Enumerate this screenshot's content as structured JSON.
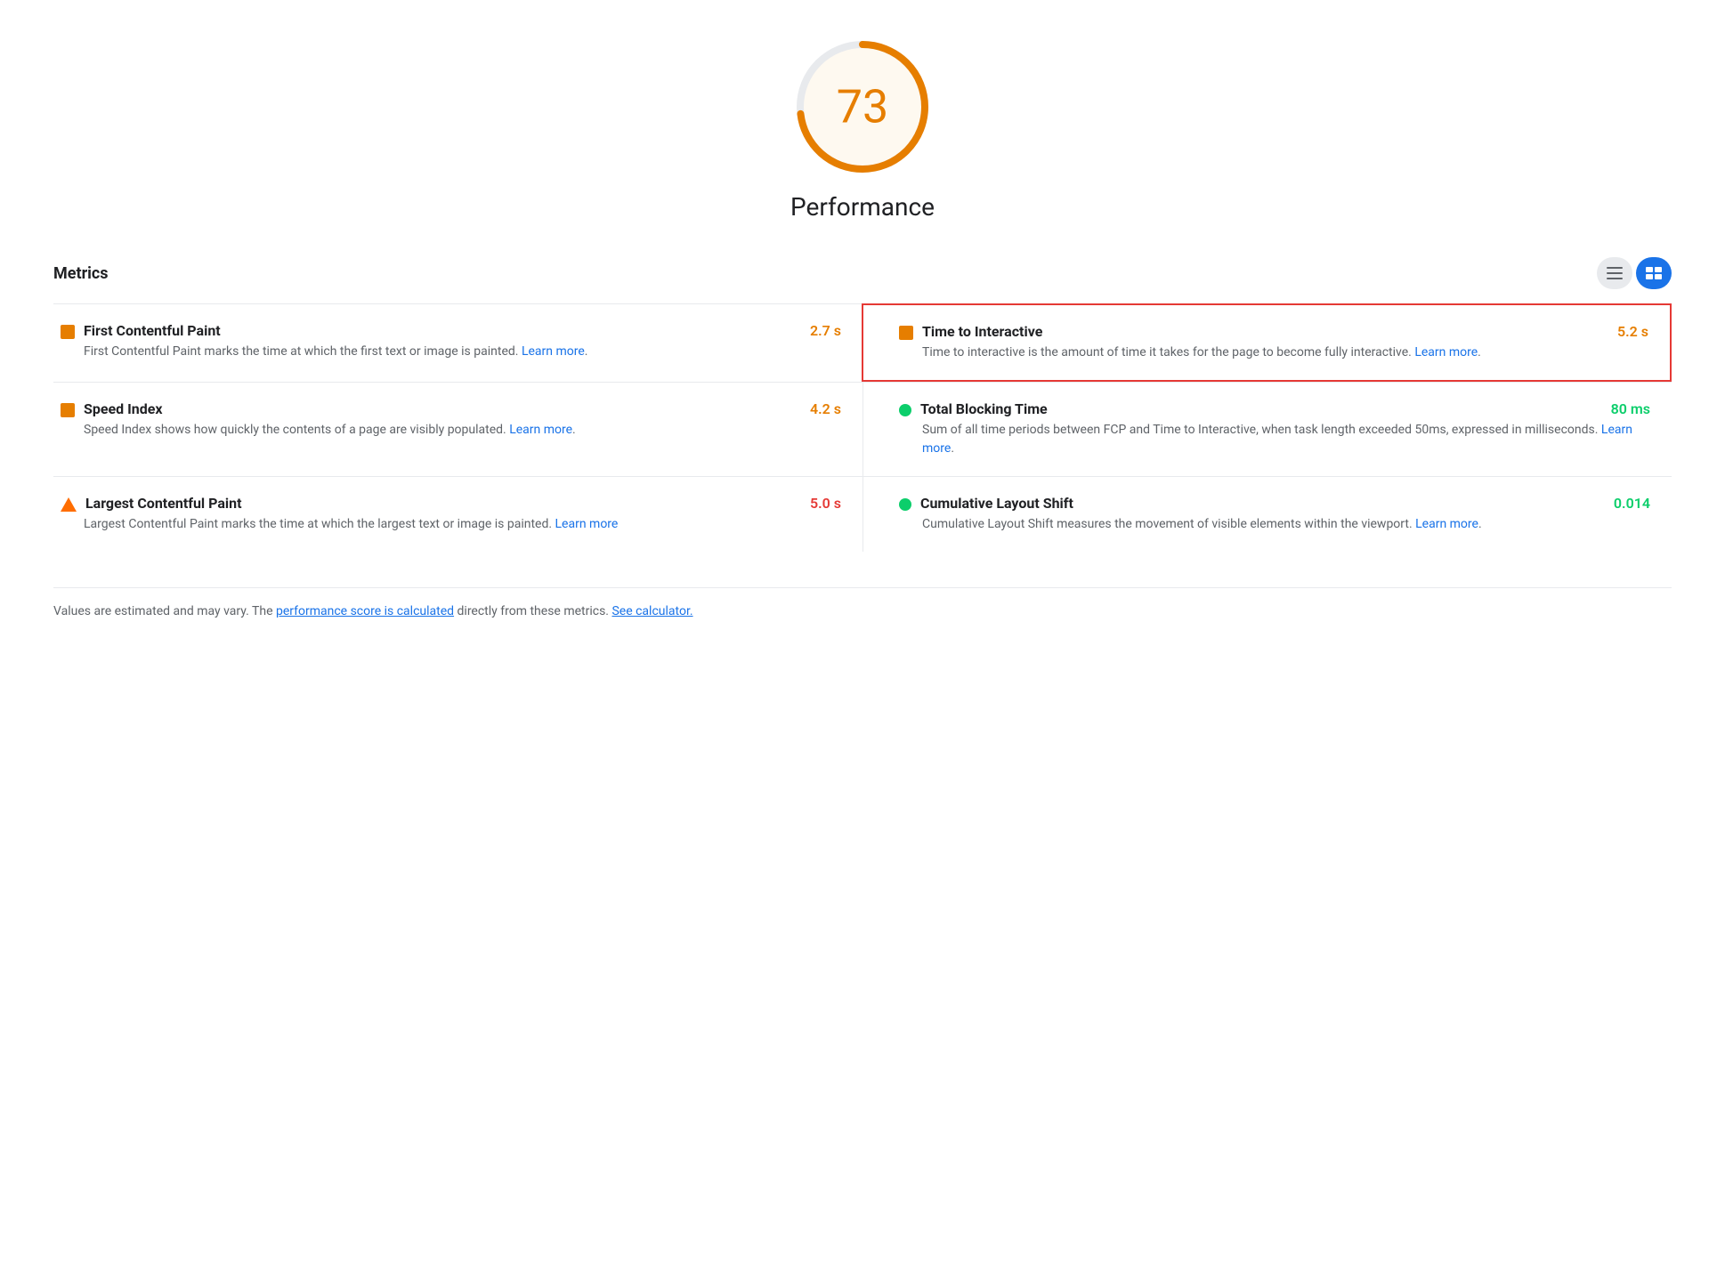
{
  "score": {
    "value": "73",
    "color": "#e67e00",
    "bg_color": "#fef9f0",
    "arc_radius": 70,
    "arc_circumference": 439.8,
    "arc_dash": 320,
    "label": "Performance"
  },
  "metrics": {
    "title": "Metrics",
    "toggle": {
      "list_icon": "≡",
      "detail_icon": "≡"
    },
    "items": [
      {
        "id": "fcp",
        "icon": "orange-square",
        "name": "First Contentful Paint",
        "value": "2.7 s",
        "value_color": "orange",
        "description": "First Contentful Paint marks the time at which the first text or image is painted.",
        "learn_more_url": "#",
        "learn_more_label": "Learn more",
        "highlighted": false,
        "position": "left",
        "row": 1
      },
      {
        "id": "tti",
        "icon": "orange-square",
        "name": "Time to Interactive",
        "value": "5.2 s",
        "value_color": "orange",
        "description": "Time to interactive is the amount of time it takes for the page to become fully interactive.",
        "learn_more_url": "#",
        "learn_more_label": "Learn more",
        "highlighted": true,
        "position": "right",
        "row": 1
      },
      {
        "id": "si",
        "icon": "orange-square",
        "name": "Speed Index",
        "value": "4.2 s",
        "value_color": "orange",
        "description": "Speed Index shows how quickly the contents of a page are visibly populated.",
        "learn_more_url": "#",
        "learn_more_label": "Learn more",
        "highlighted": false,
        "position": "left",
        "row": 2
      },
      {
        "id": "tbt",
        "icon": "green-circle",
        "name": "Total Blocking Time",
        "value": "80 ms",
        "value_color": "green",
        "description": "Sum of all time periods between FCP and Time to Interactive, when task length exceeded 50ms, expressed in milliseconds.",
        "learn_more_url": "#",
        "learn_more_label": "Learn more",
        "highlighted": false,
        "position": "right",
        "row": 2
      },
      {
        "id": "lcp",
        "icon": "orange-triangle",
        "name": "Largest Contentful Paint",
        "value": "5.0 s",
        "value_color": "red",
        "description": "Largest Contentful Paint marks the time at which the largest text or image is painted.",
        "learn_more_url": "#",
        "learn_more_label": "Learn more",
        "highlighted": false,
        "position": "left",
        "row": 3
      },
      {
        "id": "cls",
        "icon": "green-circle",
        "name": "Cumulative Layout Shift",
        "value": "0.014",
        "value_color": "green",
        "description": "Cumulative Layout Shift measures the movement of visible elements within the viewport.",
        "learn_more_url": "#",
        "learn_more_label": "Learn more",
        "highlighted": false,
        "position": "right",
        "row": 3
      }
    ]
  },
  "footer": {
    "text_before": "Values are estimated and may vary. The ",
    "link1_label": "performance score is calculated",
    "link1_url": "#",
    "text_middle": " directly from these metrics. ",
    "link2_label": "See calculator.",
    "link2_url": "#"
  }
}
